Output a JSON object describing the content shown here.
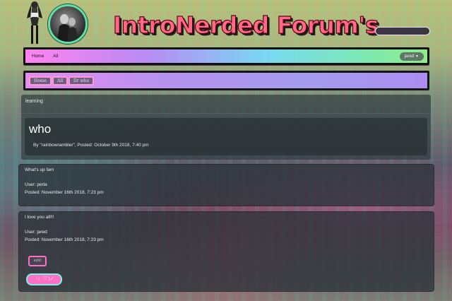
{
  "header": {
    "site_title": "IntroNerded Forum's"
  },
  "nav": {
    "home": "Home",
    "all": "All",
    "user": "jared"
  },
  "breadcrumbs": [
    "Home",
    "All",
    "Dr who"
  ],
  "category": {
    "label": "learning"
  },
  "post": {
    "title": "who",
    "meta": "By \"rainbowrambler\", Posted: October 9th 2018, 7:40 pm"
  },
  "replies": [
    {
      "text": "What's up fam",
      "user": "User: perla",
      "posted": "Posted: November 16th 2018, 7:23 pm"
    },
    {
      "text": "I love you all!!!",
      "user": "User: jared",
      "posted": "Posted: November 16th 2018, 7:23 pm",
      "edit_label": "edit",
      "emote_label": "ヽ( ´ ▽`)ノ"
    }
  ],
  "colors": {
    "title": "#ff6b86",
    "nav_gradient_start": "#ff83f0",
    "nav_gradient_end": "#8eed8a",
    "breadcrumb_bg": "#b792f0",
    "edit_border": "#ff6fc6",
    "emote_bg": "#ff6fc6",
    "emote_border": "#7ff0e2",
    "avatar_ring": "#5fe0a8"
  }
}
